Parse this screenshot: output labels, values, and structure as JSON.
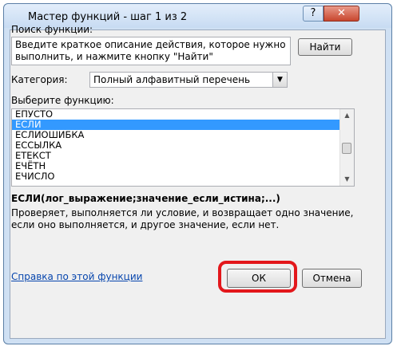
{
  "window": {
    "title": "Мастер функций - шаг 1 из 2",
    "help_glyph": "?",
    "close_glyph": "✕"
  },
  "search": {
    "label": "Поиск функции:",
    "value": "Введите краткое описание действия, которое нужно выполнить, и нажмите кнопку \"Найти\"",
    "find_button": "Найти"
  },
  "category": {
    "label": "Категория:",
    "selected": "Полный алфавитный перечень"
  },
  "functions": {
    "label": "Выберите функцию:",
    "items": [
      "ЕПУСТО",
      "ЕСЛИ",
      "ЕСЛИОШИБКА",
      "ЕССЫЛКА",
      "ЕТЕКСТ",
      "ЕЧЁТН",
      "ЕЧИСЛО"
    ],
    "selected_index": 1
  },
  "selected_function": {
    "signature": "ЕСЛИ(лог_выражение;значение_если_истина;...)",
    "description": "Проверяет, выполняется ли условие, и возвращает одно значение, если оно выполняется, и другое значение, если нет."
  },
  "footer": {
    "help_link": "Справка по этой функции",
    "ok": "ОК",
    "cancel": "Отмена"
  },
  "colors": {
    "selection": "#3399ff",
    "highlight_ring": "#e3171b",
    "link": "#0645ad"
  }
}
